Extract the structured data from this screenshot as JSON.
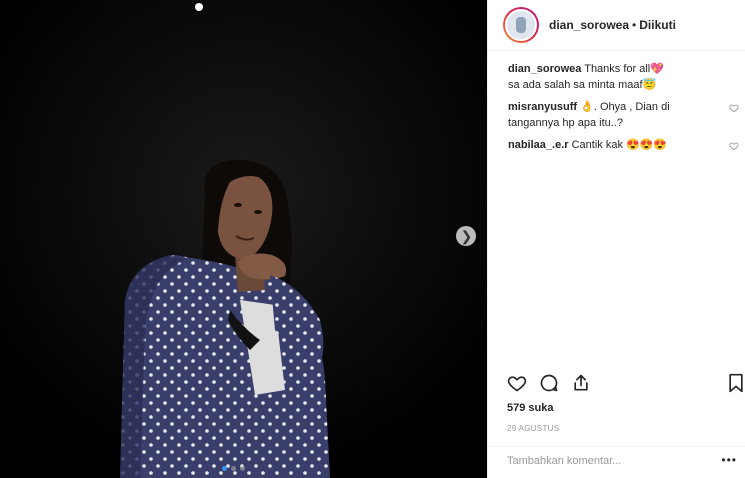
{
  "post": {
    "username": "dian_sorowea",
    "separator": "•",
    "follow_status": "Diikuti",
    "likes": "579 suka",
    "date": "29 AGUSTUS",
    "add_comment_placeholder": "Tambahkan komentar...",
    "more_menu": "•••",
    "carousel": {
      "total_slides": 3,
      "active_slide": 1
    }
  },
  "comments": [
    {
      "user": "dian_sorowea",
      "text_line1": "Thanks for all",
      "emoji1": "💖",
      "text_line2": "sa ada salah sa minta maaf",
      "emoji2": "😇",
      "show_like": false
    },
    {
      "user": "misranyusuff",
      "text": "👌. Ohya , Dian di tangannya hp apa itu..?",
      "show_like": true
    },
    {
      "user": "nabilaa_.e.r",
      "text": "Cantik kak 😍😍😍",
      "show_like": true
    }
  ],
  "colors": {
    "accent": "#3897f0",
    "text": "#262626",
    "muted": "#999999",
    "divider": "#efefef",
    "jacket": "#3b3f6e"
  },
  "icons": [
    "heart-icon",
    "comment-icon",
    "share-icon",
    "bookmark-icon",
    "chevron-right-icon",
    "more-icon"
  ]
}
